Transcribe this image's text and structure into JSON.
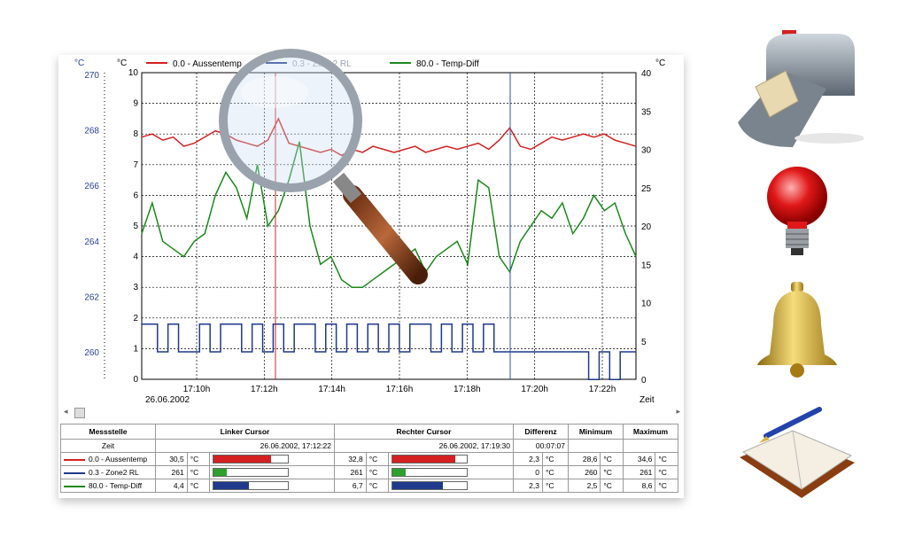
{
  "chart_data": {
    "type": "line",
    "x_ticks": [
      "17:10h",
      "17:12h",
      "17:14h",
      "17:16h",
      "17:18h",
      "17:20h",
      "17:22h"
    ],
    "date_label": "26.06.2002",
    "xlabel": "Zeit",
    "left_axis_far": {
      "unit": "°C",
      "ticks": [
        "270",
        "268",
        "266",
        "264",
        "262",
        "260"
      ],
      "color": "#2a3f9a"
    },
    "left_axis": {
      "unit": "°C",
      "ylim": [
        0,
        10
      ],
      "ticks": [
        "0",
        "1",
        "2",
        "3",
        "4",
        "5",
        "6",
        "7",
        "8",
        "9",
        "10"
      ]
    },
    "right_axis": {
      "unit": "°C",
      "ylim": [
        0,
        40
      ],
      "ticks": [
        "0",
        "5",
        "10",
        "15",
        "20",
        "25",
        "30",
        "35",
        "40"
      ]
    },
    "grid": true,
    "legend_position": "top",
    "series": [
      {
        "name": "0.0 - Aussentemp",
        "color": "#d42020",
        "axis": "left",
        "values": [
          7.9,
          8.0,
          7.8,
          7.9,
          7.6,
          7.7,
          7.9,
          8.1,
          8.0,
          7.8,
          7.7,
          7.6,
          7.8,
          8.5,
          7.7,
          7.6,
          7.5,
          7.4,
          7.5,
          7.3,
          7.5,
          7.4,
          7.6,
          7.5,
          7.4,
          7.5,
          7.6,
          7.4,
          7.5,
          7.6,
          7.5,
          7.6,
          7.7,
          7.5,
          7.8,
          8.2,
          7.6,
          7.5,
          7.7,
          7.9,
          7.8,
          7.9,
          8.0,
          7.9,
          8.0,
          7.8,
          7.7,
          7.6
        ]
      },
      {
        "name": "0.3 - Zone2 RL",
        "color": "#1f3a8c",
        "axis": "far-left",
        "values": [
          261,
          261,
          260,
          261,
          260,
          260,
          261,
          260,
          261,
          261,
          260,
          261,
          260,
          261,
          260,
          261,
          261,
          260,
          261,
          260,
          261,
          260,
          261,
          260,
          261,
          260,
          261,
          261,
          260,
          261,
          260,
          261,
          260,
          261,
          260,
          260,
          260,
          260,
          260,
          260,
          260,
          260,
          260,
          259,
          260,
          259,
          260,
          260
        ]
      },
      {
        "name": "80.0 - Temp-Diff",
        "color": "#1a8a1a",
        "axis": "right",
        "values": [
          19,
          23,
          18,
          17,
          16,
          18,
          19,
          24,
          27,
          25,
          21,
          28,
          20,
          22,
          26,
          31,
          20,
          15,
          16,
          13,
          12,
          12,
          13,
          14,
          15,
          16,
          17,
          14,
          16,
          17,
          18,
          15,
          26,
          25,
          16,
          14,
          18,
          20,
          22,
          21,
          23,
          19,
          21,
          24,
          22,
          23,
          19,
          16
        ]
      }
    ],
    "cursors": [
      {
        "name": "left",
        "position": "17:12:22",
        "color": "#d42020"
      },
      {
        "name": "right",
        "position": "17:19:30",
        "color": "#2a4fc0"
      }
    ]
  },
  "table": {
    "headers": [
      "Messstelle",
      "Linker Cursor",
      "Rechter Cursor",
      "Differenz",
      "Minimum",
      "Maximum"
    ],
    "zeit_row": {
      "label": "Zeit",
      "left": "26.06.2002, 17:12:22",
      "right": "26.06.2002, 17:19:30",
      "diff": "00:07:07"
    },
    "rows": [
      {
        "label": "0.0 - Aussentemp",
        "color": "#d42020",
        "left_val": "30,5",
        "left_unit": "°C",
        "left_fill": 0.78,
        "right_val": "32,8",
        "right_unit": "°C",
        "right_fill": 0.85,
        "diff": "2,3",
        "diff_unit": "°C",
        "min": "28,6",
        "min_unit": "°C",
        "max": "34,6",
        "max_unit": "°C"
      },
      {
        "label": "0.3 - Zone2 RL",
        "color": "#1f3a8c",
        "left_val": "261",
        "left_unit": "°C",
        "left_fill": 0.18,
        "right_val": "261",
        "right_unit": "°C",
        "right_fill": 0.18,
        "diff": "0",
        "diff_unit": "°C",
        "min": "260",
        "min_unit": "°C",
        "max": "261",
        "max_unit": "°C",
        "bar_color": "#2ea02e"
      },
      {
        "label": "80.0 - Temp-Diff",
        "color": "#1a8a1a",
        "left_val": "4,4",
        "left_unit": "°C",
        "left_fill": 0.48,
        "right_val": "6,7",
        "right_unit": "°C",
        "right_fill": 0.68,
        "diff": "2,3",
        "diff_unit": "°C",
        "min": "2,5",
        "min_unit": "°C",
        "max": "8,6",
        "max_unit": "°C",
        "bar_color": "#1f3a8c"
      }
    ]
  },
  "icons": [
    "magnifier-icon",
    "mailbox-icon",
    "lightbulb-icon",
    "bell-icon",
    "notebook-icon"
  ],
  "colors": {
    "grid": "#000000",
    "axis_blue": "#2a3f9a"
  }
}
